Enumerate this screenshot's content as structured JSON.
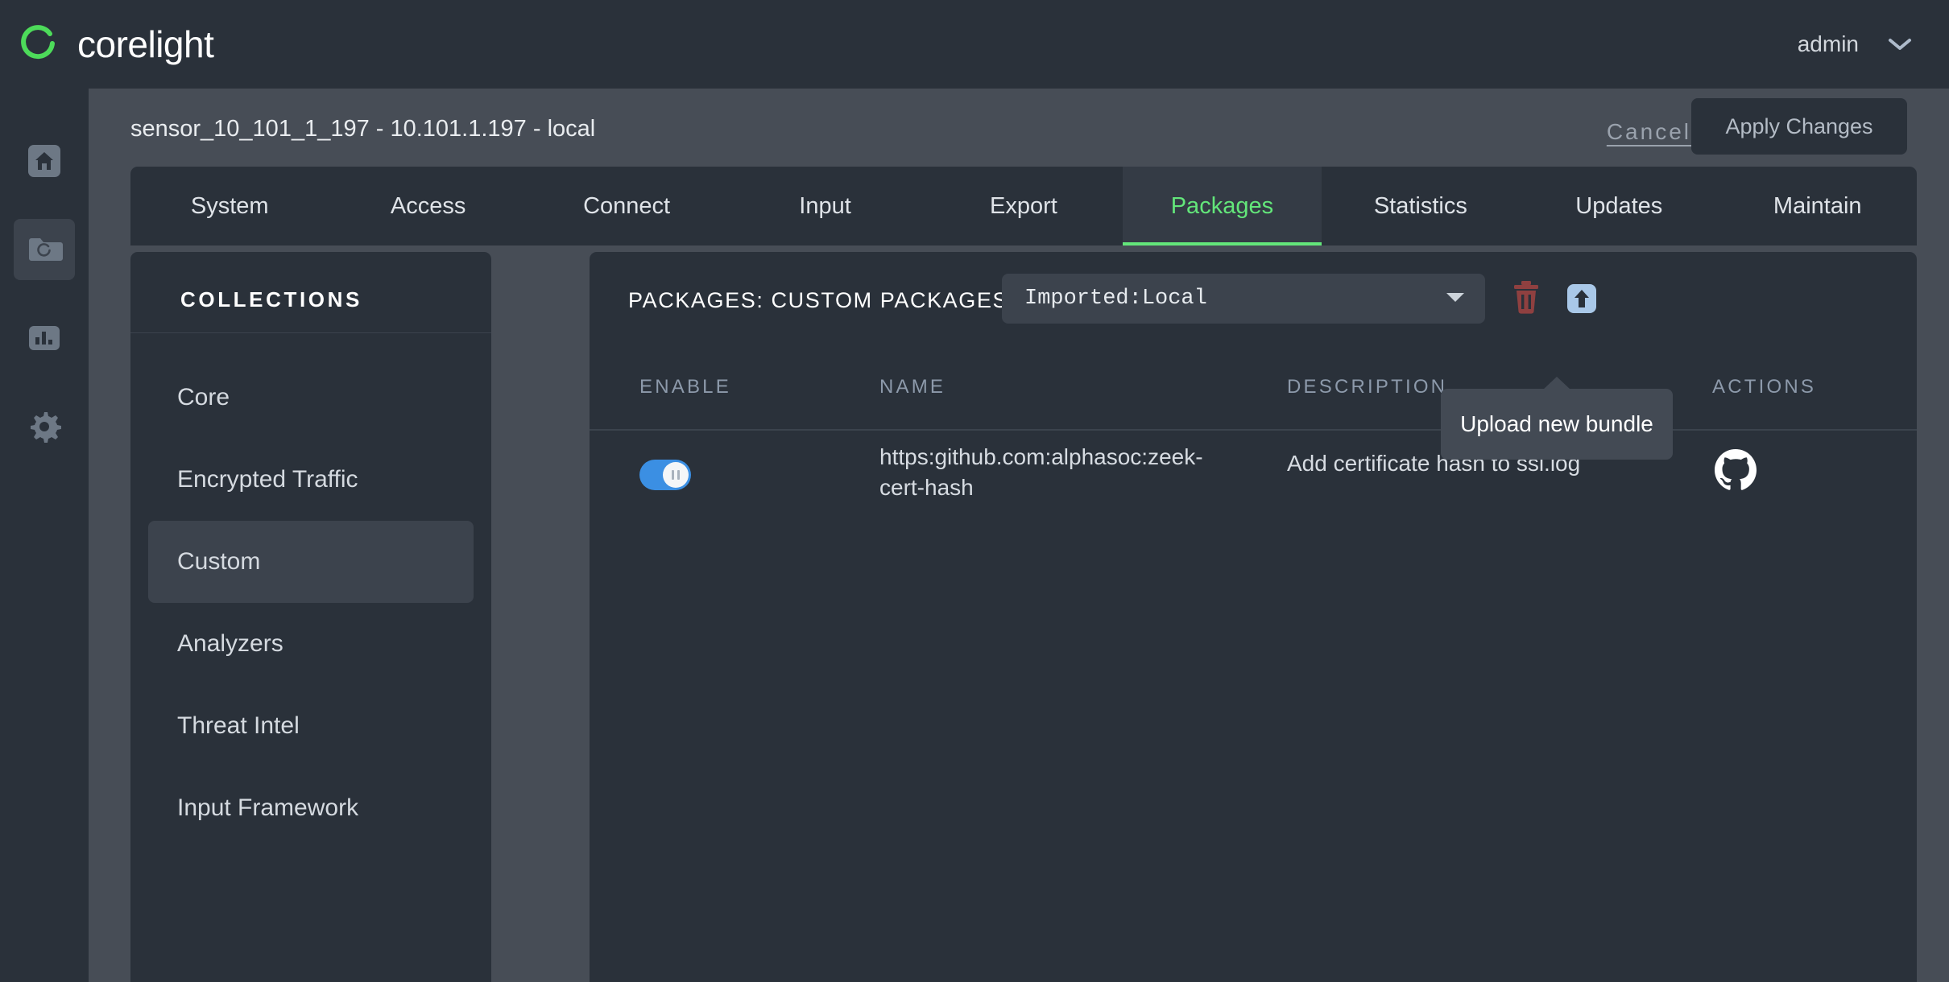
{
  "brand": {
    "name": "corelight",
    "logo_icon": "corelight-arc-logo",
    "accent": "#4ddb5a"
  },
  "header": {
    "user": "admin",
    "user_menu_icon": "chevron-down-icon"
  },
  "rail": {
    "items": [
      {
        "icon": "home-icon",
        "name": "home",
        "active": false
      },
      {
        "icon": "folder-sensor-icon",
        "name": "sensors",
        "active": true
      },
      {
        "icon": "bar-chart-icon",
        "name": "analytics",
        "active": false
      },
      {
        "icon": "gear-icon",
        "name": "settings",
        "active": false
      }
    ]
  },
  "page": {
    "title": "sensor_10_101_1_197 - 10.101.1.197 - local",
    "cancel_label": "Cancel",
    "apply_label": "Apply Changes"
  },
  "tabs": [
    {
      "label": "System",
      "active": false
    },
    {
      "label": "Access",
      "active": false
    },
    {
      "label": "Connect",
      "active": false
    },
    {
      "label": "Input",
      "active": false
    },
    {
      "label": "Export",
      "active": false
    },
    {
      "label": "Packages",
      "active": true
    },
    {
      "label": "Statistics",
      "active": false
    },
    {
      "label": "Updates",
      "active": false
    },
    {
      "label": "Maintain",
      "active": false
    }
  ],
  "collections": {
    "title": "COLLECTIONS",
    "items": [
      {
        "label": "Core",
        "active": false
      },
      {
        "label": "Encrypted Traffic",
        "active": false
      },
      {
        "label": "Custom",
        "active": true
      },
      {
        "label": "Analyzers",
        "active": false
      },
      {
        "label": "Threat Intel",
        "active": false
      },
      {
        "label": "Input Framework",
        "active": false
      }
    ]
  },
  "panel": {
    "title": "PACKAGES: CUSTOM PACKAGES",
    "source_value": "Imported:Local",
    "source_caret_icon": "caret-down-icon",
    "delete_icon": "trash-icon",
    "delete_color": "#8f4040",
    "upload_icon": "upload-icon",
    "upload_color": "#a9c8e8",
    "tooltip": "Upload new bundle"
  },
  "table": {
    "columns": [
      "ENABLE",
      "NAME",
      "DESCRIPTION",
      "ACTIONS"
    ],
    "rows": [
      {
        "enabled": true,
        "name": "https:github.com:alphasoc:zeek-cert-hash",
        "description": "Add certificate hash to ssl.log",
        "action_icon": "github-icon"
      }
    ]
  }
}
